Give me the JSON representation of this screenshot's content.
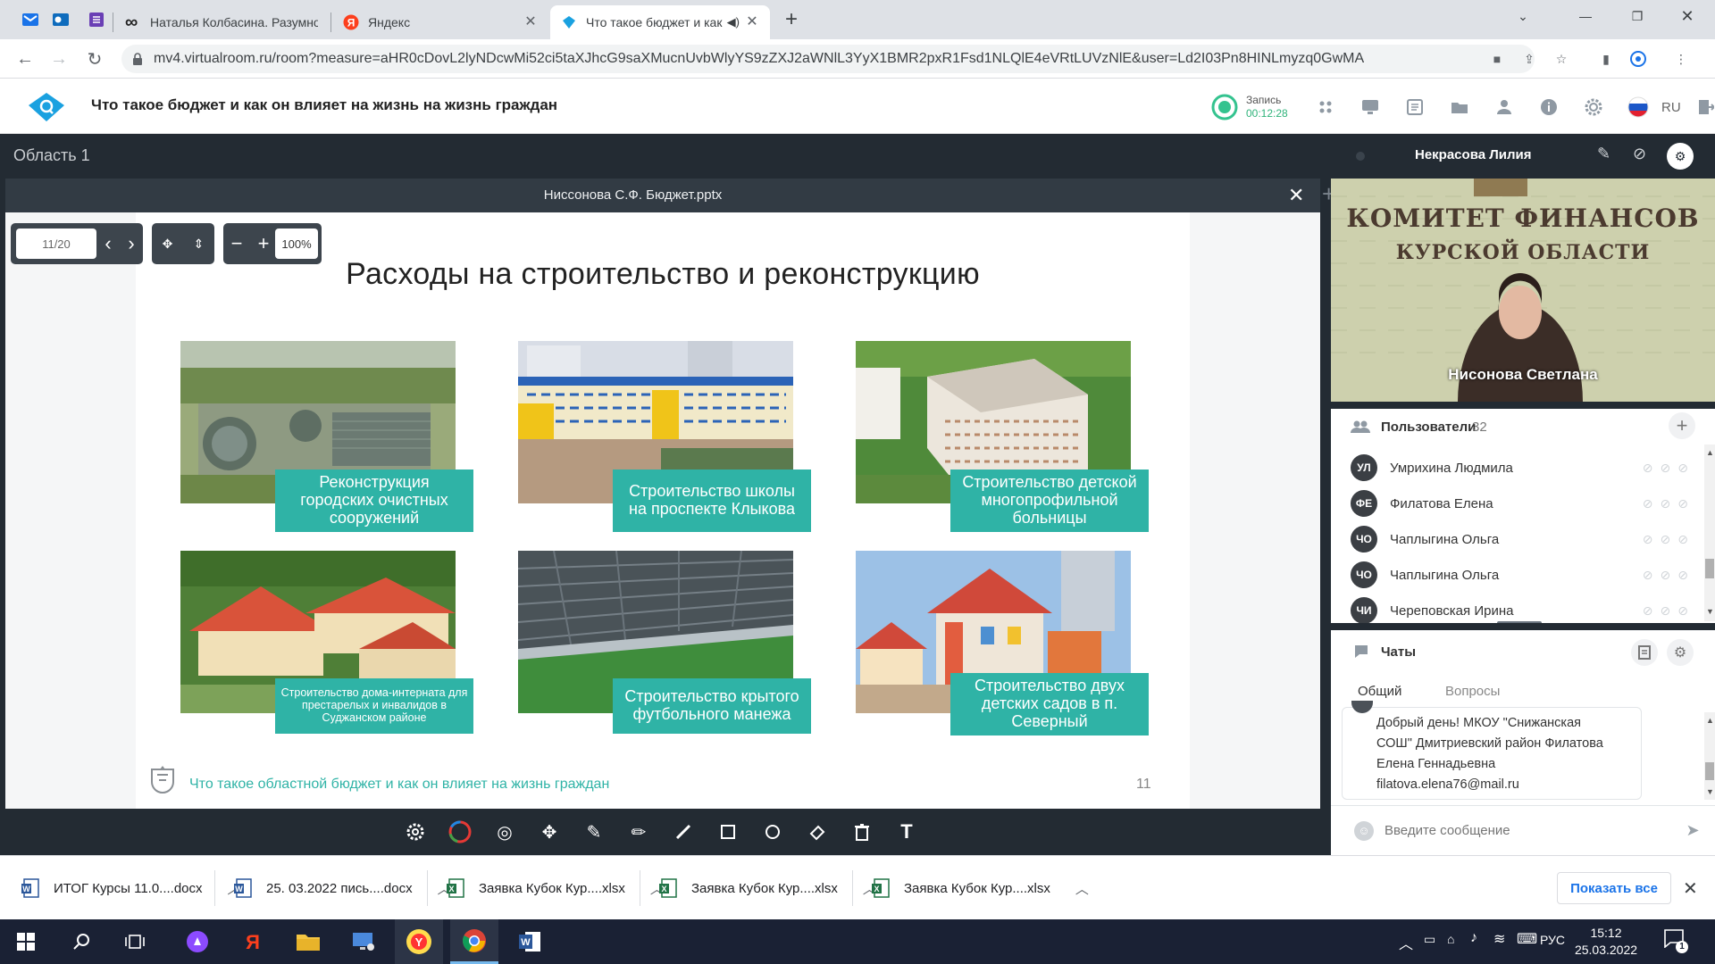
{
  "browser": {
    "tabs": [
      {
        "title": "Наталья Колбасина. Разумное п",
        "active": false
      },
      {
        "title": "Яндекс",
        "active": false
      },
      {
        "title": "Что такое бюджет и как он",
        "active": true
      }
    ],
    "url": "mv4.virtualroom.ru/room?measure=aHR0cDovL2lyNDcwMi52ci5taXJhcG9saXMucnUvbWlyYS9zZXJ2aWNlL3YyX1BMR2pxR1Fsd1NLQlE4eVRtLUVzNlE&user=Ld2I03Pn8HINLmyzq0GwMA"
  },
  "app": {
    "title": "Что такое бюджет и как он влияет на жизнь на жизнь граждан",
    "record_label": "Запись",
    "record_time": "00:12:28",
    "language": "RU",
    "accent": "#2fb3a6"
  },
  "workspace": {
    "area_label": "Область 1",
    "document_name": "Ниссонова С.Ф. Бюджет.pptx",
    "page_indicator": "11/20",
    "zoom": "100%"
  },
  "slide": {
    "title": "Расходы на строительство и реконструкцию",
    "captions": [
      "Реконструкция городских очистных сооружений",
      "Строительство школы на проспекте Клыкова",
      "Строительство детской многопрофильной больницы",
      "Строительство дома-интерната для престарелых и инвалидов в Суджанском районе",
      "Строительство крытого футбольного манежа",
      "Строительство двух детских садов в п. Северный"
    ],
    "footer": "Что такое областной бюджет и как он влияет на жизнь граждан",
    "page_number": "11"
  },
  "video": {
    "participant": "Некрасова Лилия",
    "speaker_label": "Нисонова Светлана",
    "wall_text_1": "КОМИТЕТ ФИНАНСОВ",
    "wall_text_2": "КУРСКОЙ ОБЛАСТИ"
  },
  "users": {
    "label": "Пользователи",
    "count": "32",
    "list": [
      {
        "initials": "УЛ",
        "name": "Умрихина Людмила"
      },
      {
        "initials": "ФЕ",
        "name": "Филатова Елена"
      },
      {
        "initials": "ЧО",
        "name": "Чаплыгина Ольга"
      },
      {
        "initials": "ЧО",
        "name": "Чаплыгина Ольга"
      },
      {
        "initials": "ЧИ",
        "name": "Череповская Ирина"
      }
    ]
  },
  "chats": {
    "label": "Чаты",
    "tab_general": "Общий",
    "tab_questions": "Вопросы",
    "message_lines": [
      "Добрый день! МКОУ \"Снижанская",
      "СОШ\" Дмитриевский район Филатова",
      "Елена Геннадьевна",
      "filatova.elena76@mail.ru"
    ],
    "input_placeholder": "Введите сообщение"
  },
  "downloads": {
    "items": [
      "ИТОГ Курсы 11.0....docx",
      "25. 03.2022 пись....docx",
      "Заявка Кубок Кур....xlsx",
      "Заявка Кубок Кур....xlsx",
      "Заявка Кубок Кур....xlsx"
    ],
    "show_all": "Показать все"
  },
  "taskbar": {
    "lang": "РУС",
    "time": "15:12",
    "date": "25.03.2022",
    "notifications": "1"
  }
}
